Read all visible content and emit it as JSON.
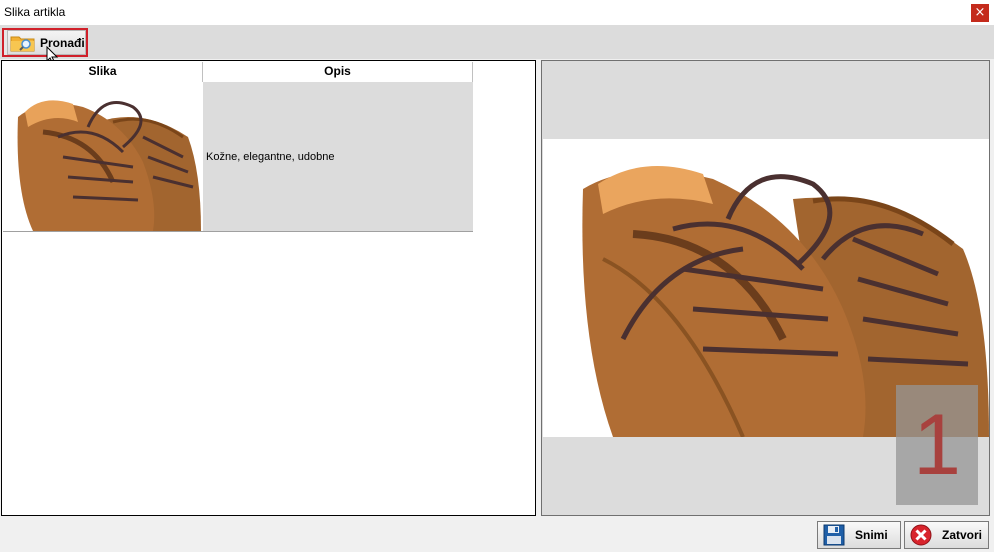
{
  "window": {
    "title": "Slika artikla",
    "close_glyph": "×"
  },
  "toolbar": {
    "find_label": "Pronađi",
    "find_icon": "folder-search-icon"
  },
  "grid": {
    "columns": [
      "Slika",
      "Opis"
    ],
    "rows": [
      {
        "image": "brown-leather-shoes",
        "description": "Kožne, elegantne, udobne"
      }
    ]
  },
  "preview": {
    "image": "brown-leather-shoes",
    "page_number": "1"
  },
  "footer": {
    "save_label": "Snimi",
    "close_label": "Zatvori"
  },
  "colors": {
    "highlight_border": "#d0202a",
    "close_red": "#c42b1c",
    "shoe_brown": "#a0612e",
    "badge_number": "#a8413e"
  }
}
